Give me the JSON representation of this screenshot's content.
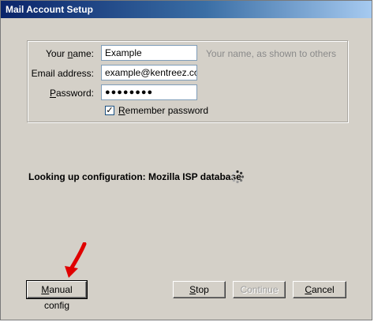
{
  "window": {
    "title": "Mail Account Setup"
  },
  "form": {
    "name_label_pre": "Your ",
    "name_label_key": "n",
    "name_label_post": "ame:",
    "name_value": "Example",
    "name_hint": "Your name, as shown to others",
    "email_label": "Email address:",
    "email_value": "example@kentreez.com",
    "password_label_key": "P",
    "password_label_post": "assword:",
    "password_value": "●●●●●●●●",
    "remember_checked": true,
    "remember_label_key": "R",
    "remember_label_post": "emember password"
  },
  "status": {
    "text": "Looking up configuration: Mozilla ISP database"
  },
  "buttons": {
    "manual_key": "M",
    "manual_post": "anual config",
    "stop_key": "S",
    "stop_post": "top",
    "continue_label": "Continue",
    "cancel_key": "C",
    "cancel_post": "ancel"
  },
  "colors": {
    "title_start": "#0a246a",
    "title_end": "#a6caf0",
    "arrow": "#e00000"
  }
}
